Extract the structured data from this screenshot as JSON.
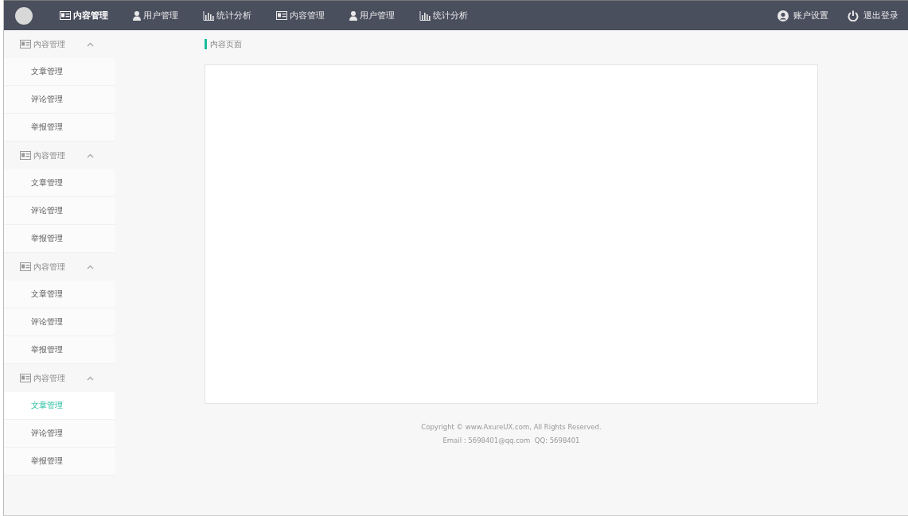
{
  "topnav": [
    {
      "label": "内容管理",
      "kind": "card",
      "selected": true
    },
    {
      "label": "用户管理",
      "kind": "user",
      "selected": false
    },
    {
      "label": "统计分析",
      "kind": "chart",
      "selected": false
    },
    {
      "label": "内容管理",
      "kind": "card",
      "selected": false
    },
    {
      "label": "用户管理",
      "kind": "user",
      "selected": false
    },
    {
      "label": "统计分析",
      "kind": "chart",
      "selected": false
    }
  ],
  "account": [
    {
      "label": "账户设置",
      "kind": "account"
    },
    {
      "label": "退出登录",
      "kind": "power"
    }
  ],
  "sidebar": [
    {
      "label": "内容管理",
      "expanded": true,
      "children": [
        {
          "label": "文章管理",
          "selected": false
        },
        {
          "label": "评论管理",
          "selected": false
        },
        {
          "label": "举报管理",
          "selected": false
        }
      ]
    },
    {
      "label": "内容管理",
      "expanded": true,
      "children": [
        {
          "label": "文章管理",
          "selected": false
        },
        {
          "label": "评论管理",
          "selected": false
        },
        {
          "label": "举报管理",
          "selected": false
        }
      ]
    },
    {
      "label": "内容管理",
      "expanded": true,
      "children": [
        {
          "label": "文章管理",
          "selected": false
        },
        {
          "label": "评论管理",
          "selected": false
        },
        {
          "label": "举报管理",
          "selected": false
        }
      ]
    },
    {
      "label": "内容管理",
      "expanded": true,
      "children": [
        {
          "label": "文章管理",
          "selected": true
        },
        {
          "label": "评论管理",
          "selected": false
        },
        {
          "label": "举报管理",
          "selected": false
        }
      ]
    }
  ],
  "breadcrumb": "内容页面",
  "footer": [
    "Copyright © www.AxureUX.com, All Rights Reserved.",
    "Email : 5698401@qq.com  QQ: 5698401"
  ]
}
